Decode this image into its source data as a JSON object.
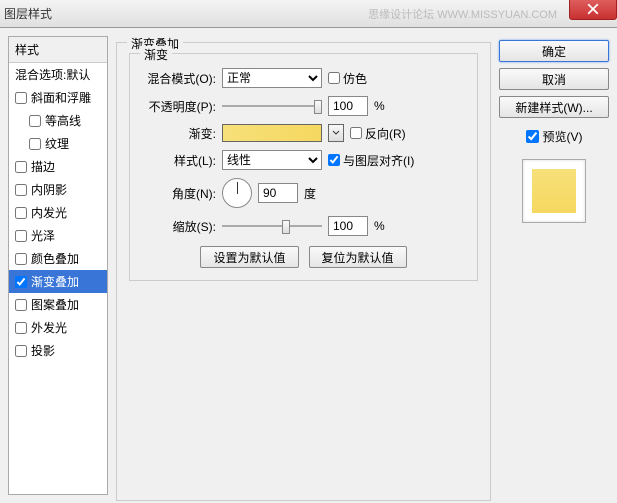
{
  "window": {
    "title": "图层样式",
    "watermark": "思缘设计论坛  WWW.MISSYUAN.COM"
  },
  "sidebar": {
    "header": "样式",
    "blending": "混合选项:默认",
    "items": [
      {
        "label": "斜面和浮雕",
        "checked": false
      },
      {
        "label": "等高线",
        "checked": false,
        "sub": true
      },
      {
        "label": "纹理",
        "checked": false,
        "sub": true
      },
      {
        "label": "描边",
        "checked": false
      },
      {
        "label": "内阴影",
        "checked": false
      },
      {
        "label": "内发光",
        "checked": false
      },
      {
        "label": "光泽",
        "checked": false
      },
      {
        "label": "颜色叠加",
        "checked": false
      },
      {
        "label": "渐变叠加",
        "checked": true,
        "selected": true
      },
      {
        "label": "图案叠加",
        "checked": false
      },
      {
        "label": "外发光",
        "checked": false
      },
      {
        "label": "投影",
        "checked": false
      }
    ]
  },
  "panel": {
    "group_title": "渐变叠加",
    "sub_title": "渐变",
    "blend_label": "混合模式(O):",
    "blend_value": "正常",
    "dither_label": "仿色",
    "opacity_label": "不透明度(P):",
    "opacity_value": "100",
    "percent": "%",
    "gradient_label": "渐变:",
    "reverse_label": "反向(R)",
    "style_label": "样式(L):",
    "style_value": "线性",
    "align_label": "与图层对齐(I)",
    "angle_label": "角度(N):",
    "angle_value": "90",
    "degree": "度",
    "scale_label": "缩放(S):",
    "scale_value": "100",
    "reset_default": "设置为默认值",
    "revert_default": "复位为默认值"
  },
  "right": {
    "ok": "确定",
    "cancel": "取消",
    "new_style": "新建样式(W)...",
    "preview": "预览(V)"
  }
}
